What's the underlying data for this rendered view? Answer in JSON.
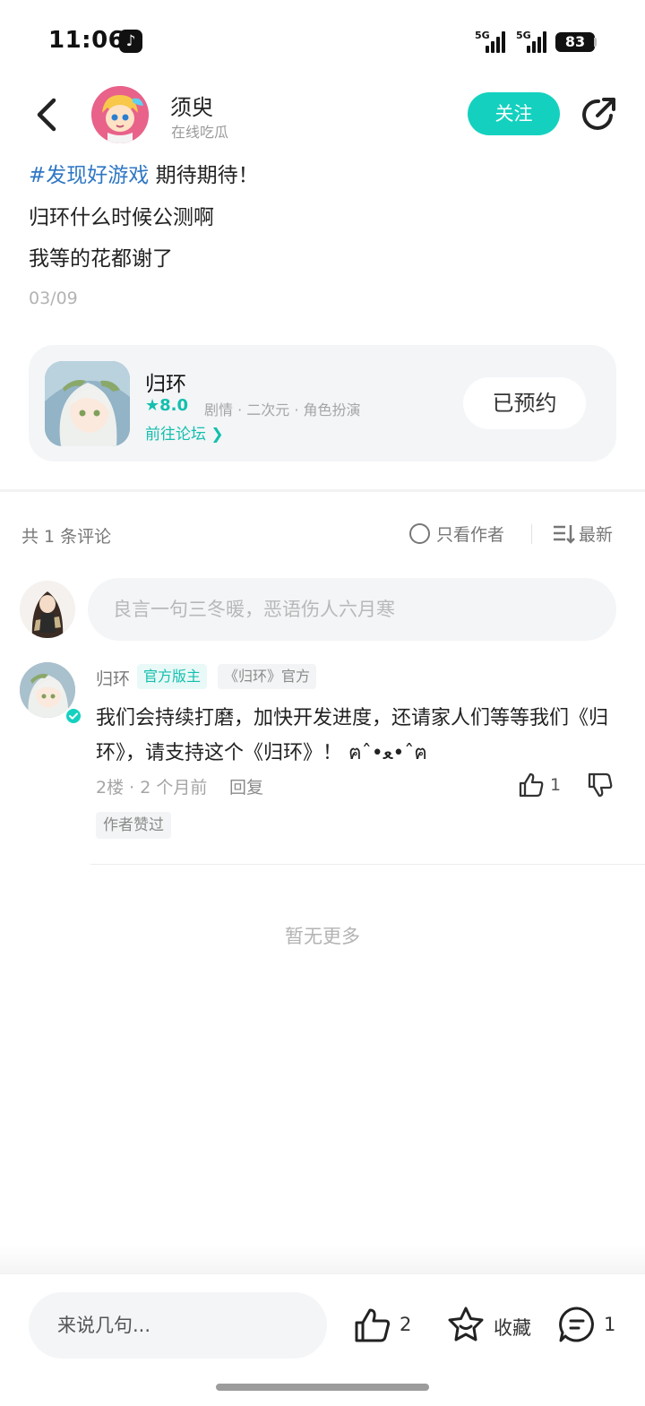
{
  "status_bar": {
    "time": "11:06",
    "app_icon": "tiktok-icon",
    "signal_1_label": "5G",
    "signal_2_label": "5G",
    "battery": "83"
  },
  "header": {
    "user_name": "须臾",
    "user_status": "在线吃瓜",
    "follow_label": "关注"
  },
  "post": {
    "hashtag": "#发现好游戏",
    "line1_rest": " 期待期待！",
    "line2": "归环什么时候公测啊",
    "line3": "我等的花都谢了",
    "date": "03/09"
  },
  "game_card": {
    "name": "归环",
    "score": "★8.0",
    "tags": "剧情 · 二次元 · 角色扮演",
    "forum_link": "前往论坛",
    "reserved_label": "已预约"
  },
  "comments": {
    "count_label": "共 1 条评论",
    "only_author_label": "只看作者",
    "sort_label": "最新",
    "input_placeholder": "良言一句三冬暖，恶语伤人六月寒",
    "no_more": "暂无更多",
    "items": [
      {
        "author": "归环",
        "badge_mod": "官方版主",
        "badge_official": "《归环》官方",
        "text": "我们会持续打磨，加快开发进度，还请家人们等等我们《归环》，请支持这个《归环》！ ฅˆ•ﻌ•ˆฅ",
        "meta": "2楼 · 2 个月前",
        "reply_label": "回复",
        "likes": "1",
        "author_liked": "作者赞过"
      }
    ]
  },
  "bottom_bar": {
    "input_placeholder": "来说几句...",
    "like_count": "2",
    "favorite_label": "收藏",
    "comment_count": "1"
  },
  "colors": {
    "accent": "#14d1bf",
    "hashtag": "#2f77c4",
    "muted": "#a5a5a5"
  }
}
